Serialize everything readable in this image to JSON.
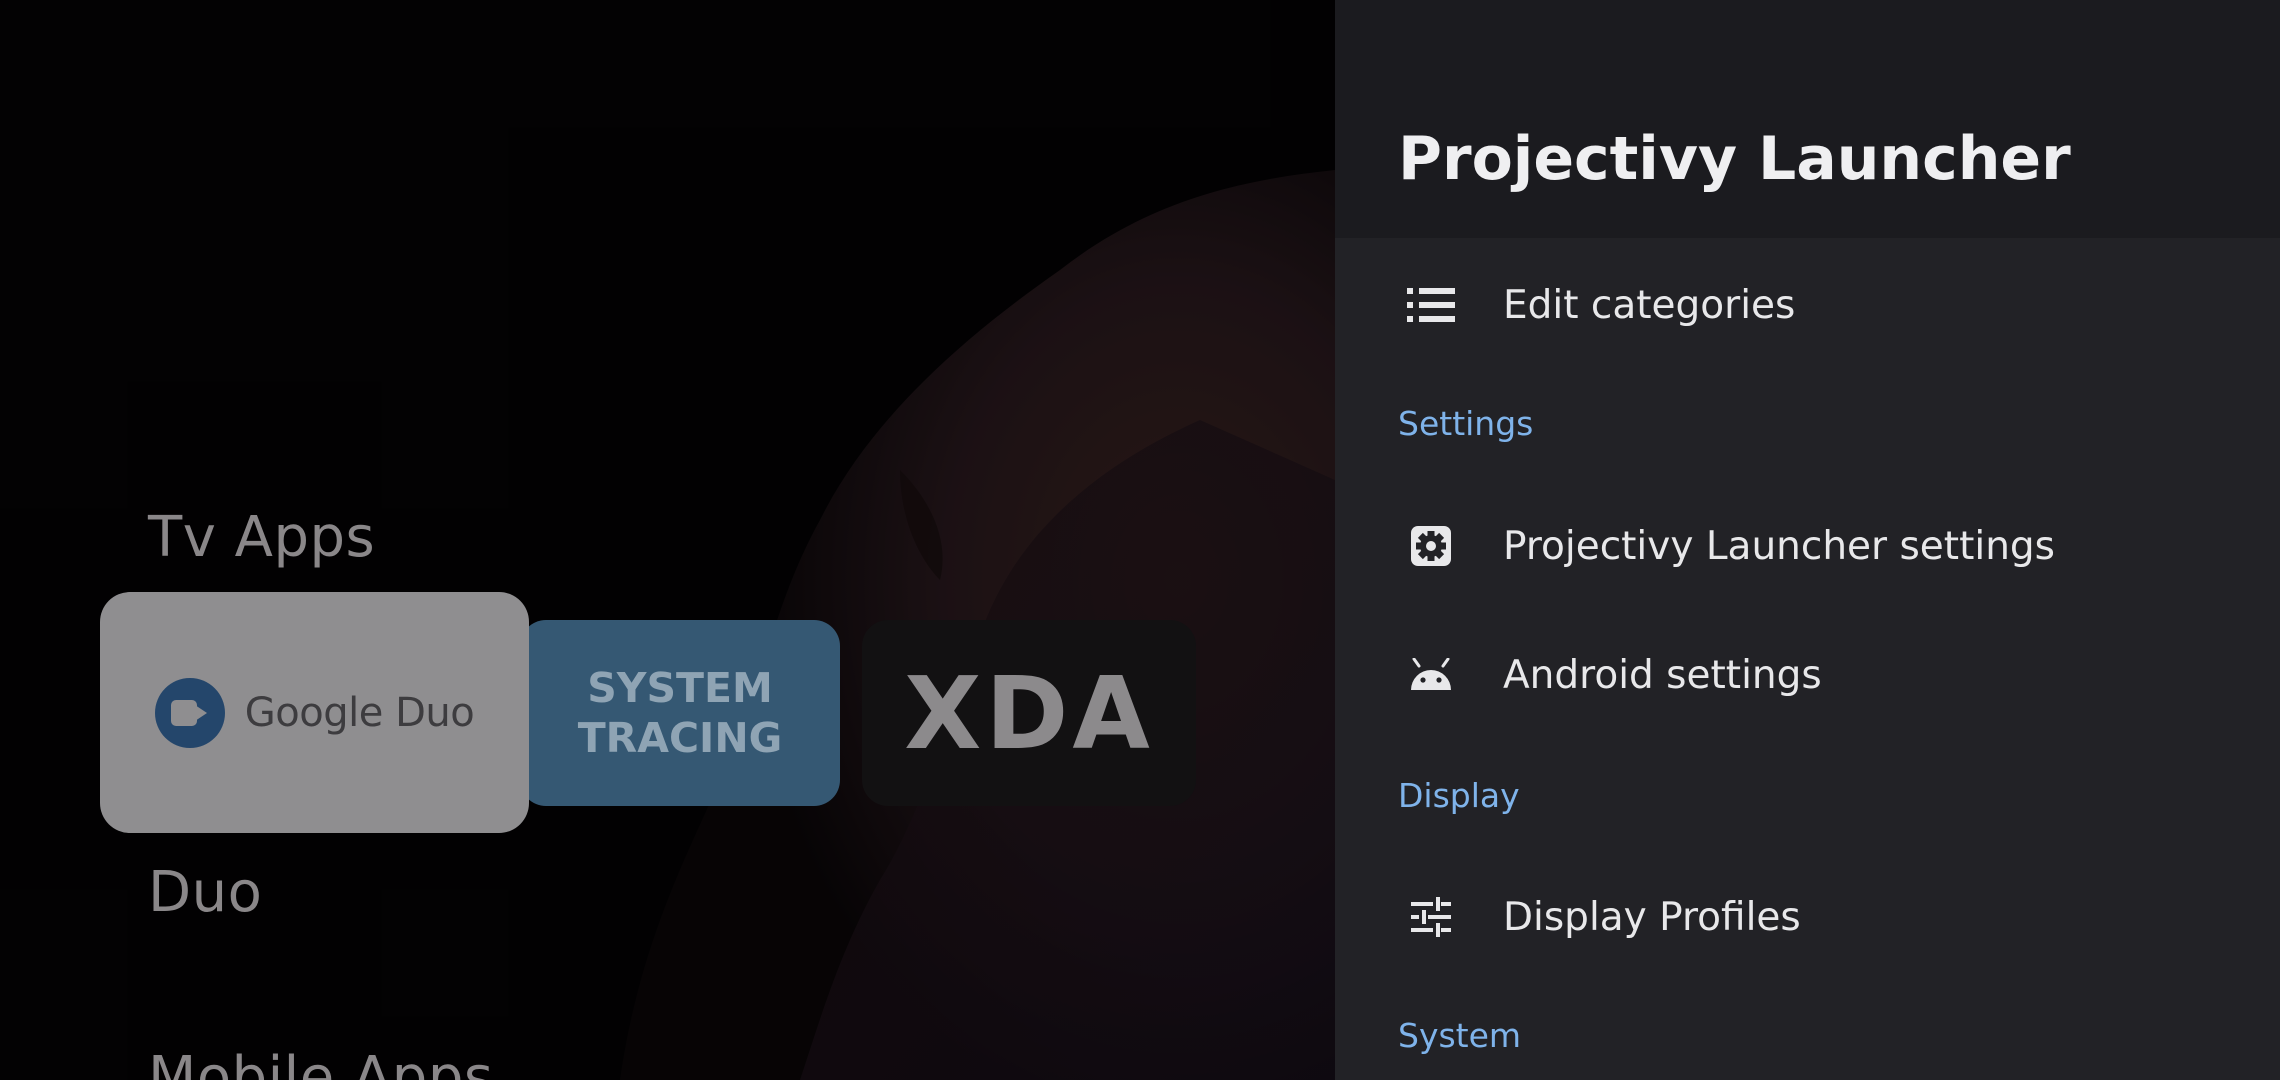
{
  "launcher": {
    "rows": [
      {
        "title": "Tv Apps"
      },
      {
        "title": "Duo"
      },
      {
        "title": "Mobile Apps"
      }
    ],
    "tiles": {
      "duo": {
        "text": "Google Duo"
      },
      "tracing": {
        "line1": "SYSTEM",
        "line2": "TRACING"
      },
      "xda": {
        "text": "XDA"
      }
    }
  },
  "panel": {
    "title": "Projectivy Launcher",
    "edit_categories": {
      "label": "Edit categories",
      "icon": "list-icon"
    },
    "settings_header": "Settings",
    "launcher_settings": {
      "label": "Projectivy Launcher settings",
      "icon": "gear-icon"
    },
    "android_settings": {
      "label": "Android settings",
      "icon": "android-icon"
    },
    "display_header": "Display",
    "display_profiles": {
      "label": "Display Profiles",
      "icon": "tune-icon"
    },
    "system_header": "System"
  },
  "colors": {
    "panel_bg": "#222226",
    "panel_header_bg": "#1b1b1f",
    "section_accent": "#7fb3ea"
  }
}
